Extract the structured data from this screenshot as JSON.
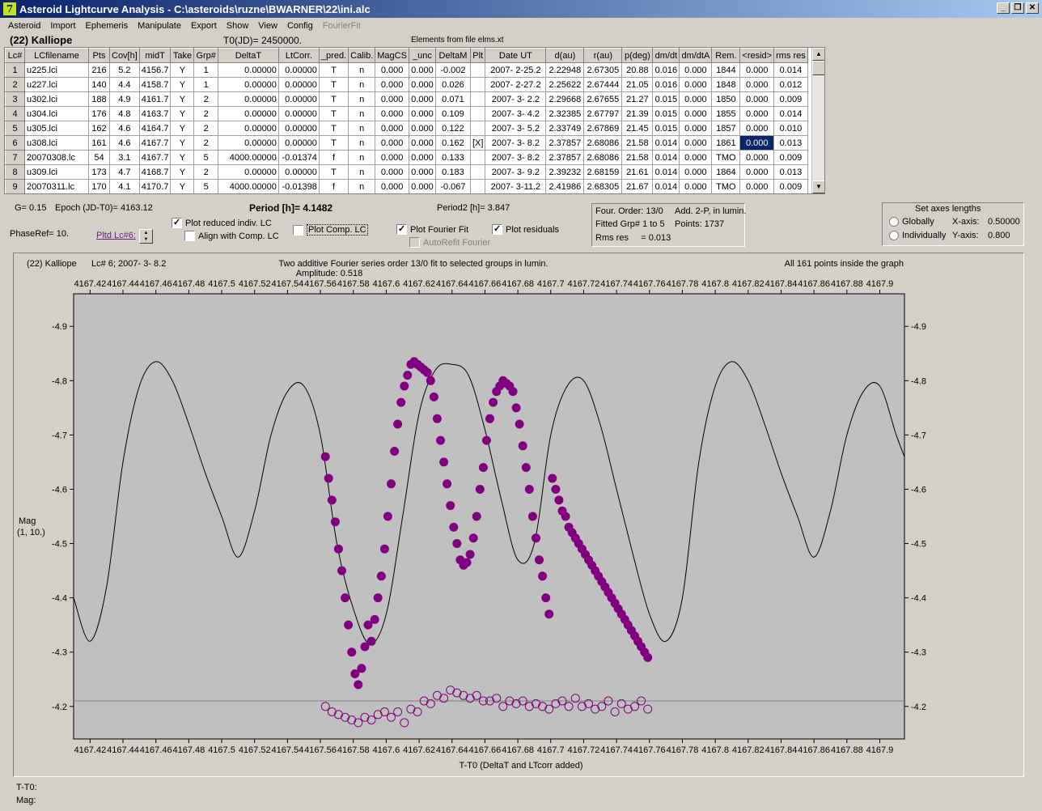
{
  "window": {
    "title": "Asteroid Lightcurve Analysis - C:\\asteroids\\ruzne\\BWARNER\\22\\ini.alc",
    "icon_glyph": "7",
    "minimize_glyph": "_",
    "restore_glyph": "❐",
    "close_glyph": "✕"
  },
  "menu": [
    {
      "label": "Asteroid",
      "enabled": true
    },
    {
      "label": "Import",
      "enabled": true
    },
    {
      "label": "Ephemeris",
      "enabled": true
    },
    {
      "label": "Manipulate",
      "enabled": true
    },
    {
      "label": "Export",
      "enabled": true
    },
    {
      "label": "Show",
      "enabled": true
    },
    {
      "label": "View",
      "enabled": true
    },
    {
      "label": "Config",
      "enabled": true
    },
    {
      "label": "FourierFit",
      "enabled": false
    }
  ],
  "header": {
    "object": "(22) Kalliope",
    "t0": "T0(JD)= 2450000.",
    "elements": "Elements from file elms.xt"
  },
  "table": {
    "columns": [
      "Lc#",
      "LCfilename",
      "Pts",
      "Cov[h]",
      "midT",
      "Take",
      "Grp#",
      "DeltaT",
      "LtCorr.",
      "_pred.",
      "Calib.",
      "MagCS",
      "_unc",
      "DeltaM",
      "Plt",
      "Date UT",
      "d(au)",
      "r(au)",
      "p(deg)",
      "dm/dt",
      "dm/dtA",
      "Rem.",
      "<resid>",
      "rms res"
    ],
    "rows": [
      [
        "1",
        "u225.lci",
        "216",
        "5.2",
        "4156.7",
        "Y",
        "1",
        "0.00000",
        "0.00000",
        "T",
        "n",
        "0.000",
        "0.000",
        "-0.002",
        "",
        "2007- 2-25.2",
        "2.22948",
        "2.67305",
        "20.88",
        "0.016",
        "0.000",
        "1844",
        "0.000",
        "0.014"
      ],
      [
        "2",
        "u227.lci",
        "140",
        "4.4",
        "4158.7",
        "Y",
        "1",
        "0.00000",
        "0.00000",
        "T",
        "n",
        "0.000",
        "0.000",
        "0.026",
        "",
        "2007- 2-27.2",
        "2.25622",
        "2.67444",
        "21.05",
        "0.016",
        "0.000",
        "1848",
        "0.000",
        "0.012"
      ],
      [
        "3",
        "u302.lci",
        "188",
        "4.9",
        "4161.7",
        "Y",
        "2",
        "0.00000",
        "0.00000",
        "T",
        "n",
        "0.000",
        "0.000",
        "0.071",
        "",
        "2007- 3- 2.2",
        "2.29668",
        "2.67655",
        "21.27",
        "0.015",
        "0.000",
        "1850",
        "0.000",
        "0.009"
      ],
      [
        "4",
        "u304.lci",
        "176",
        "4.8",
        "4163.7",
        "Y",
        "2",
        "0.00000",
        "0.00000",
        "T",
        "n",
        "0.000",
        "0.000",
        "0.109",
        "",
        "2007- 3- 4.2",
        "2.32385",
        "2.67797",
        "21.39",
        "0.015",
        "0.000",
        "1855",
        "0.000",
        "0.014"
      ],
      [
        "5",
        "u305.lci",
        "162",
        "4.6",
        "4164.7",
        "Y",
        "2",
        "0.00000",
        "0.00000",
        "T",
        "n",
        "0.000",
        "0.000",
        "0.122",
        "",
        "2007- 3- 5.2",
        "2.33749",
        "2.67869",
        "21.45",
        "0.015",
        "0.000",
        "1857",
        "0.000",
        "0.010"
      ],
      [
        "6",
        "u308.lci",
        "161",
        "4.6",
        "4167.7",
        "Y",
        "2",
        "0.00000",
        "0.00000",
        "T",
        "n",
        "0.000",
        "0.000",
        "0.162",
        "[X]",
        "2007- 3- 8.2",
        "2.37857",
        "2.68086",
        "21.58",
        "0.014",
        "0.000",
        "1861",
        "0.000",
        "0.013"
      ],
      [
        "7",
        "20070308.lc",
        "54",
        "3.1",
        "4167.7",
        "Y",
        "5",
        "4000.00000",
        "-0.01374",
        "f",
        "n",
        "0.000",
        "0.000",
        "0.133",
        "",
        "2007- 3- 8.2",
        "2.37857",
        "2.68086",
        "21.58",
        "0.014",
        "0.000",
        "TMO",
        "0.000",
        "0.009"
      ],
      [
        "8",
        "u309.lci",
        "173",
        "4.7",
        "4168.7",
        "Y",
        "2",
        "0.00000",
        "0.00000",
        "T",
        "n",
        "0.000",
        "0.000",
        "0.183",
        "",
        "2007- 3- 9.2",
        "2.39232",
        "2.68159",
        "21.61",
        "0.014",
        "0.000",
        "1864",
        "0.000",
        "0.013"
      ],
      [
        "9",
        "20070311.lc",
        "170",
        "4.1",
        "4170.7",
        "Y",
        "5",
        "4000.00000",
        "-0.01398",
        "f",
        "n",
        "0.000",
        "0.000",
        "-0.067",
        "",
        "2007- 3-11.2",
        "2.41986",
        "2.68305",
        "21.67",
        "0.014",
        "0.000",
        "TMO",
        "0.000",
        "0.009"
      ]
    ],
    "selected_cell": {
      "row": 5,
      "col": 22
    },
    "scroll_up": "▲",
    "scroll_down": "▼"
  },
  "controls": {
    "g": "G= 0.15",
    "epoch": "Epoch (JD-T0)= 4163.12",
    "period": "Period [h]= 4.1482",
    "period2": "Period2 [h]= 3.847",
    "phaseref": "PhaseRef= 10.",
    "pltd_lc": "Pltd Lc#6:",
    "plot_reduced": {
      "label": "Plot reduced indiv. LC",
      "checked": true
    },
    "align_comp": {
      "label": "Align with Comp. LC",
      "checked": false
    },
    "plot_comp": {
      "label": "Plot Comp. LC",
      "checked": false
    },
    "plot_fourier": {
      "label": "Plot Fourier Fit",
      "checked": true
    },
    "autorefit": {
      "label": "AutoRefit Fourier",
      "checked": false
    },
    "plot_residuals": {
      "label": "Plot residuals",
      "checked": true
    },
    "check_glyph": "✓",
    "spin_up": "▲",
    "spin_down": "▼"
  },
  "fit_info": {
    "order": "Four. Order: 13/0",
    "mode": "Add. 2-P, in lumin.",
    "fitted": "Fitted Grp# 1 to 5",
    "points": "Points: 1737",
    "rms": "Rms res     = 0.013"
  },
  "axes_lengths": {
    "title": "Set axes lengths",
    "globally": "Globally",
    "individually": "Individually",
    "x_label": "X-axis:",
    "x_value": "0.50000",
    "y_label": "Y-axis:",
    "y_value": "0.800"
  },
  "plot": {
    "object": "(22) Kalliope",
    "lc_info": "Lc# 6; 2007- 3- 8.2",
    "title": "Two additive Fourier series order 13/0 fit to selected groups in lumin.",
    "amplitude": "Amplitude: 0.518",
    "points_note": "All 161 points inside the graph",
    "ylabel_line1": "Mag",
    "ylabel_line2": "(1, 10.)",
    "xlabel": "T-T0 (DeltaT and LTcorr added)",
    "colors": {
      "points": "#800080",
      "curve": "#000000",
      "background": "#c0c0c0"
    }
  },
  "chart_data": {
    "type": "scatter",
    "title": "Two additive Fourier series order 13/0 fit to selected groups in lumin.",
    "xlabel": "T-T0 (DeltaT and LTcorr added)",
    "ylabel": "Mag",
    "xlim": [
      4167.41,
      4167.915
    ],
    "ylim": [
      -4.96,
      -4.14
    ],
    "y_inverted": true,
    "xticks": [
      4167.42,
      4167.44,
      4167.46,
      4167.48,
      4167.5,
      4167.52,
      4167.54,
      4167.56,
      4167.58,
      4167.6,
      4167.62,
      4167.64,
      4167.66,
      4167.68,
      4167.7,
      4167.72,
      4167.74,
      4167.76,
      4167.78,
      4167.8,
      4167.82,
      4167.84,
      4167.86,
      4167.88,
      4167.9
    ],
    "yticks": [
      -4.9,
      -4.8,
      -4.7,
      -4.6,
      -4.5,
      -4.4,
      -4.3,
      -4.2
    ],
    "fourier_curve": {
      "x": [
        4167.41,
        4167.42,
        4167.43,
        4167.44,
        4167.45,
        4167.46,
        4167.47,
        4167.48,
        4167.49,
        4167.5,
        4167.51,
        4167.52,
        4167.53,
        4167.54,
        4167.55,
        4167.56,
        4167.57,
        4167.58,
        4167.59,
        4167.6,
        4167.61,
        4167.62,
        4167.63,
        4167.64,
        4167.65,
        4167.66,
        4167.67,
        4167.68,
        4167.69,
        4167.7,
        4167.71,
        4167.72,
        4167.73,
        4167.74,
        4167.75,
        4167.76,
        4167.77,
        4167.78,
        4167.79,
        4167.8,
        4167.81,
        4167.82,
        4167.83,
        4167.84,
        4167.85,
        4167.86,
        4167.87,
        4167.88,
        4167.89,
        4167.9,
        4167.91,
        4167.915
      ],
      "y": [
        -4.4,
        -4.32,
        -4.42,
        -4.65,
        -4.79,
        -4.835,
        -4.8,
        -4.72,
        -4.63,
        -4.55,
        -4.475,
        -4.56,
        -4.7,
        -4.78,
        -4.79,
        -4.7,
        -4.5,
        -4.38,
        -4.315,
        -4.37,
        -4.55,
        -4.74,
        -4.82,
        -4.83,
        -4.81,
        -4.71,
        -4.58,
        -4.47,
        -4.5,
        -4.7,
        -4.79,
        -4.8,
        -4.72,
        -4.6,
        -4.48,
        -4.37,
        -4.32,
        -4.4,
        -4.65,
        -4.79,
        -4.835,
        -4.8,
        -4.72,
        -4.63,
        -4.55,
        -4.475,
        -4.56,
        -4.7,
        -4.78,
        -4.79,
        -4.7,
        -4.66
      ]
    },
    "residual_zero": -4.21,
    "series": [
      {
        "marker": "filled-circle",
        "x": [
          4167.563,
          4167.565,
          4167.567,
          4167.569,
          4167.571,
          4167.573,
          4167.575,
          4167.577,
          4167.579,
          4167.581,
          4167.583,
          4167.585,
          4167.587,
          4167.589,
          4167.591,
          4167.593,
          4167.595,
          4167.597,
          4167.599,
          4167.601,
          4167.603,
          4167.605,
          4167.607,
          4167.609,
          4167.611,
          4167.613,
          4167.615,
          4167.617,
          4167.619,
          4167.621,
          4167.623,
          4167.625,
          4167.627,
          4167.629,
          4167.631,
          4167.633,
          4167.635,
          4167.637,
          4167.639,
          4167.641,
          4167.643,
          4167.645,
          4167.647,
          4167.649,
          4167.651,
          4167.653,
          4167.655,
          4167.657,
          4167.659,
          4167.661,
          4167.663,
          4167.665,
          4167.667,
          4167.669,
          4167.671,
          4167.673,
          4167.675,
          4167.677,
          4167.679,
          4167.681,
          4167.683,
          4167.685,
          4167.687,
          4167.689,
          4167.691,
          4167.693,
          4167.695,
          4167.697,
          4167.699,
          4167.701,
          4167.703,
          4167.705,
          4167.707,
          4167.709,
          4167.711,
          4167.713,
          4167.715,
          4167.717,
          4167.719,
          4167.721,
          4167.723,
          4167.725,
          4167.727,
          4167.729,
          4167.731,
          4167.733,
          4167.735,
          4167.737,
          4167.739,
          4167.741,
          4167.743,
          4167.745,
          4167.747,
          4167.749,
          4167.751,
          4167.753,
          4167.755,
          4167.757,
          4167.759
        ],
        "y": [
          -4.66,
          -4.62,
          -4.58,
          -4.54,
          -4.49,
          -4.45,
          -4.4,
          -4.35,
          -4.3,
          -4.26,
          -4.24,
          -4.27,
          -4.31,
          -4.35,
          -4.32,
          -4.36,
          -4.4,
          -4.44,
          -4.49,
          -4.55,
          -4.61,
          -4.67,
          -4.72,
          -4.76,
          -4.79,
          -4.81,
          -4.83,
          -4.835,
          -4.83,
          -4.825,
          -4.82,
          -4.815,
          -4.8,
          -4.77,
          -4.73,
          -4.69,
          -4.65,
          -4.61,
          -4.57,
          -4.53,
          -4.5,
          -4.47,
          -4.46,
          -4.465,
          -4.48,
          -4.51,
          -4.55,
          -4.6,
          -4.64,
          -4.69,
          -4.73,
          -4.76,
          -4.78,
          -4.79,
          -4.8,
          -4.795,
          -4.79,
          -4.78,
          -4.75,
          -4.72,
          -4.68,
          -4.64,
          -4.6,
          -4.55,
          -4.51,
          -4.47,
          -4.44,
          -4.4,
          -4.37,
          -4.62,
          -4.6,
          -4.58,
          -4.56,
          -4.55,
          -4.53,
          -4.52,
          -4.51,
          -4.5,
          -4.49,
          -4.48,
          -4.47,
          -4.46,
          -4.45,
          -4.44,
          -4.43,
          -4.42,
          -4.41,
          -4.4,
          -4.39,
          -4.38,
          -4.37,
          -4.36,
          -4.35,
          -4.34,
          -4.33,
          -4.32,
          -4.31,
          -4.3,
          -4.29
        ]
      },
      {
        "marker": "open-circle",
        "x": [
          4167.563,
          4167.567,
          4167.571,
          4167.575,
          4167.579,
          4167.583,
          4167.587,
          4167.591,
          4167.595,
          4167.599,
          4167.603,
          4167.607,
          4167.611,
          4167.615,
          4167.619,
          4167.623,
          4167.627,
          4167.631,
          4167.635,
          4167.639,
          4167.643,
          4167.647,
          4167.651,
          4167.655,
          4167.659,
          4167.663,
          4167.667,
          4167.671,
          4167.675,
          4167.679,
          4167.683,
          4167.687,
          4167.691,
          4167.695,
          4167.699,
          4167.703,
          4167.707,
          4167.711,
          4167.715,
          4167.719,
          4167.723,
          4167.727,
          4167.731,
          4167.735,
          4167.739,
          4167.743,
          4167.747,
          4167.751,
          4167.755,
          4167.759
        ],
        "y": [
          -4.2,
          -4.19,
          -4.185,
          -4.18,
          -4.175,
          -4.17,
          -4.18,
          -4.175,
          -4.185,
          -4.19,
          -4.18,
          -4.19,
          -4.17,
          -4.195,
          -4.19,
          -4.21,
          -4.205,
          -4.22,
          -4.215,
          -4.23,
          -4.225,
          -4.22,
          -4.215,
          -4.22,
          -4.21,
          -4.21,
          -4.215,
          -4.2,
          -4.21,
          -4.205,
          -4.21,
          -4.2,
          -4.205,
          -4.2,
          -4.195,
          -4.205,
          -4.21,
          -4.2,
          -4.215,
          -4.2,
          -4.205,
          -4.195,
          -4.2,
          -4.21,
          -4.19,
          -4.205,
          -4.195,
          -4.2,
          -4.21,
          -4.195
        ]
      }
    ]
  },
  "status": {
    "t_label": "T-T0:",
    "mag_label": "Mag:"
  }
}
